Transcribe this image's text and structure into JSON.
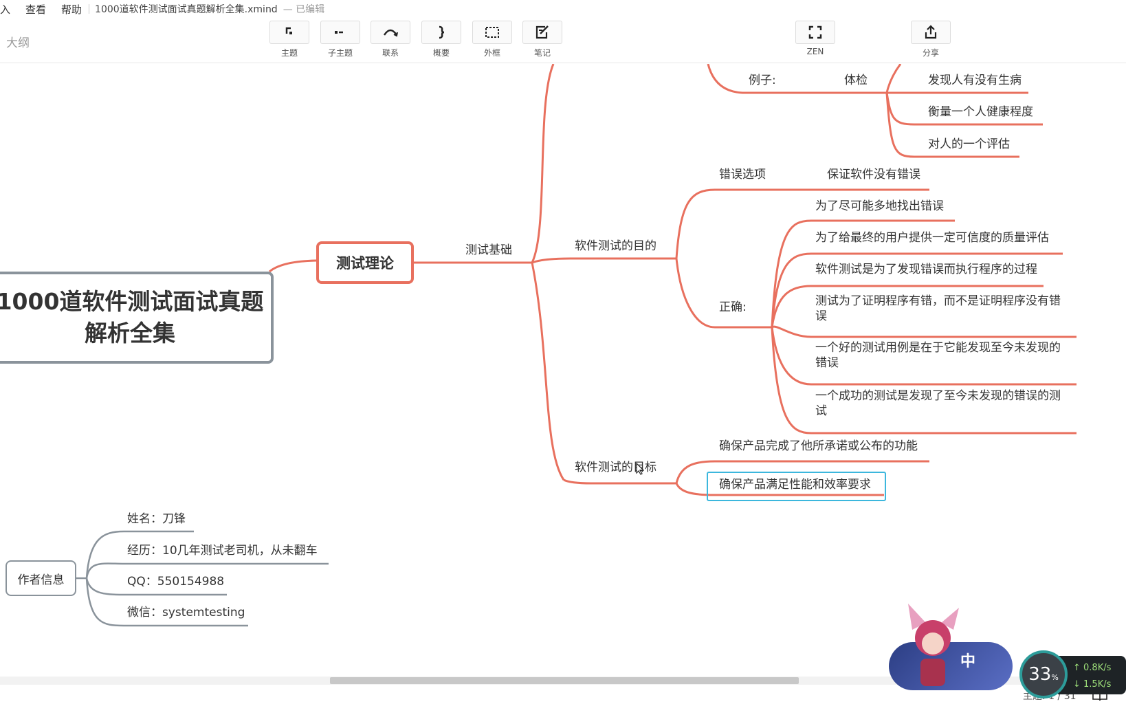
{
  "menubar": {
    "items": [
      "入",
      "查看",
      "帮助"
    ],
    "doc_title": "1000道软件测试面试真题解析全集.xmind",
    "edited": "— 已编辑"
  },
  "toolbar": {
    "outline": "大纲",
    "tools": [
      {
        "label": "主题",
        "icon": "topic-icon"
      },
      {
        "label": "子主题",
        "icon": "subtopic-icon"
      },
      {
        "label": "联系",
        "icon": "relationship-icon"
      },
      {
        "label": "概要",
        "icon": "summary-icon"
      },
      {
        "label": "外框",
        "icon": "boundary-icon"
      },
      {
        "label": "笔记",
        "icon": "note-icon"
      },
      {
        "label": "ZEN",
        "icon": "fullscreen-icon"
      },
      {
        "label": "分享",
        "icon": "share-icon"
      }
    ]
  },
  "map": {
    "central": "1000道软件测试面试真题解析全集",
    "main_topic": "测试理论",
    "branch": "测试基础",
    "example": {
      "label": "例子:",
      "sub": "体检",
      "items": [
        "发现人有没有生病",
        "衡量一个人健康程度",
        "对人的一个评估"
      ]
    },
    "purpose": {
      "label": "软件测试的目的",
      "wrong_label": "错误选项",
      "wrong_item": "保证软件没有错误",
      "right_label": "正确:",
      "right_items": [
        "为了尽可能多地找出错误",
        "为了给最终的用户提供一定可信度的质量评估",
        "软件测试是为了发现错误而执行程序的过程",
        "测试为了证明程序有错，而不是证明程序没有错误",
        "一个好的测试用例是在于它能发现至今未发现的错误",
        "一个成功的测试是发现了至今未发现的错误的测试"
      ]
    },
    "goal": {
      "label": "软件测试的目标",
      "items": [
        "确保产品完成了他所承诺或公布的功能",
        "确保产品满足性能和效率要求"
      ]
    },
    "author": {
      "label": "作者信息",
      "items": [
        "姓名：刀锋",
        "经历：10几年测试老司机，从未翻车",
        "QQ：550154988",
        "微信：systemtesting"
      ]
    }
  },
  "status": {
    "topics": "主题: 1 / 31"
  },
  "overlay": {
    "ime_char": "中",
    "cpu_percent": "33",
    "cpu_unit": "%",
    "up_rate": "0.8K/s",
    "down_rate": "1.5K/s"
  },
  "colors": {
    "branch": "#e8705e",
    "author_branch": "#8a939b",
    "selection": "#3cb7dd"
  }
}
